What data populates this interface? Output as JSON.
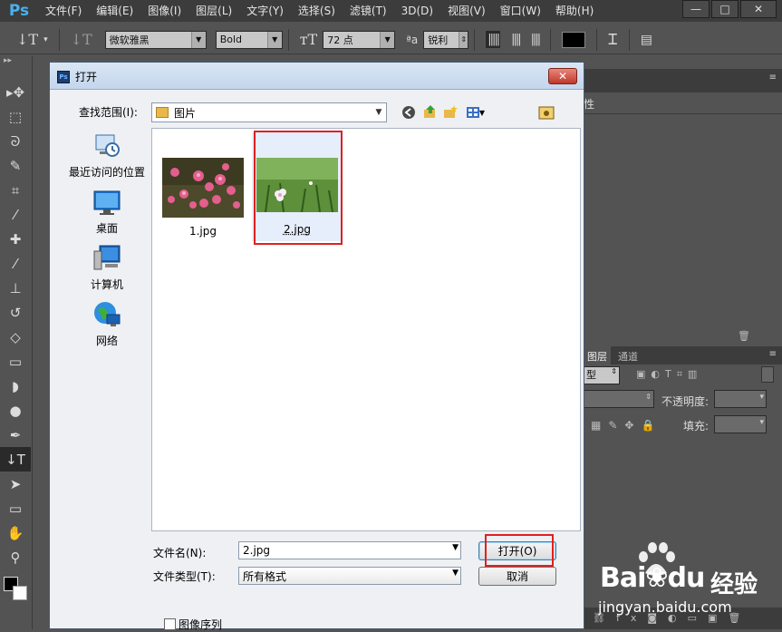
{
  "app": {
    "logo": "Ps",
    "menu": [
      "文件(F)",
      "编辑(E)",
      "图像(I)",
      "图层(L)",
      "文字(Y)",
      "选择(S)",
      "滤镜(T)",
      "3D(D)",
      "视图(V)",
      "窗口(W)",
      "帮助(H)"
    ],
    "window_buttons": {
      "minimize": "—",
      "maximize": "□",
      "close": "✕"
    }
  },
  "options_bar": {
    "font_family": "微软雅黑",
    "font_style": "Bold",
    "font_size": "72 点",
    "aa_label": "ªa",
    "antialias": "锐利",
    "text_color": "#000000"
  },
  "tools": [
    "move-icon",
    "marquee-icon",
    "lasso-icon",
    "quick-select-icon",
    "crop-icon",
    "eyedropper-icon",
    "healing-icon",
    "brush-icon",
    "stamp-icon",
    "history-brush-icon",
    "eraser-icon",
    "gradient-icon",
    "blur-icon",
    "dodge-icon",
    "pen-icon",
    "type-icon",
    "path-select-icon",
    "shape-icon",
    "hand-icon",
    "zoom-icon"
  ],
  "right_panel": {
    "tabs": [
      "图层",
      "通道"
    ],
    "kind_label": "型",
    "opacity_label": "不透明度:",
    "fill_label": "填充:",
    "partial_label": "性"
  },
  "dialog": {
    "title": "打开",
    "lookin_label": "查找范围(I):",
    "lookin_value": "图片",
    "places": [
      {
        "label": "最近访问的位置",
        "icon": "recent-places-icon"
      },
      {
        "label": "桌面",
        "icon": "desktop-icon"
      },
      {
        "label": "计算机",
        "icon": "computer-icon"
      },
      {
        "label": "网络",
        "icon": "network-icon"
      }
    ],
    "files": [
      {
        "name": "1.jpg",
        "selected": false
      },
      {
        "name": "2.jpg",
        "selected": true
      }
    ],
    "filename_label": "文件名(N):",
    "filename_value": "2.jpg",
    "filetype_label": "文件类型(T):",
    "filetype_value": "所有格式",
    "open_button": "打开(O)",
    "cancel_button": "取消",
    "image_sequence_label": "图像序列"
  },
  "watermark": {
    "brand": "Bai",
    "brand_tail": "du",
    "product": "经验",
    "url": "jingyan.baidu.com"
  }
}
